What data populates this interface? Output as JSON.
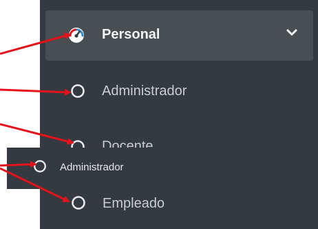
{
  "menu": {
    "header": {
      "label": "Personal",
      "icon": "dashboard-gauge-icon",
      "chevron": "chevron-down-icon"
    },
    "items": [
      {
        "label": "Administrador",
        "icon": "circle-outline-icon"
      },
      {
        "label": "Docente",
        "icon": "circle-outline-icon"
      },
      {
        "label": "Empleado",
        "icon": "circle-outline-icon"
      }
    ]
  },
  "tooltip": {
    "label": "Administrador",
    "icon": "circle-outline-icon"
  },
  "colors": {
    "sidebar_bg": "#343a40",
    "header_bg": "#494e53",
    "arrow": "#e3131b",
    "text": "#c9cdd2"
  }
}
